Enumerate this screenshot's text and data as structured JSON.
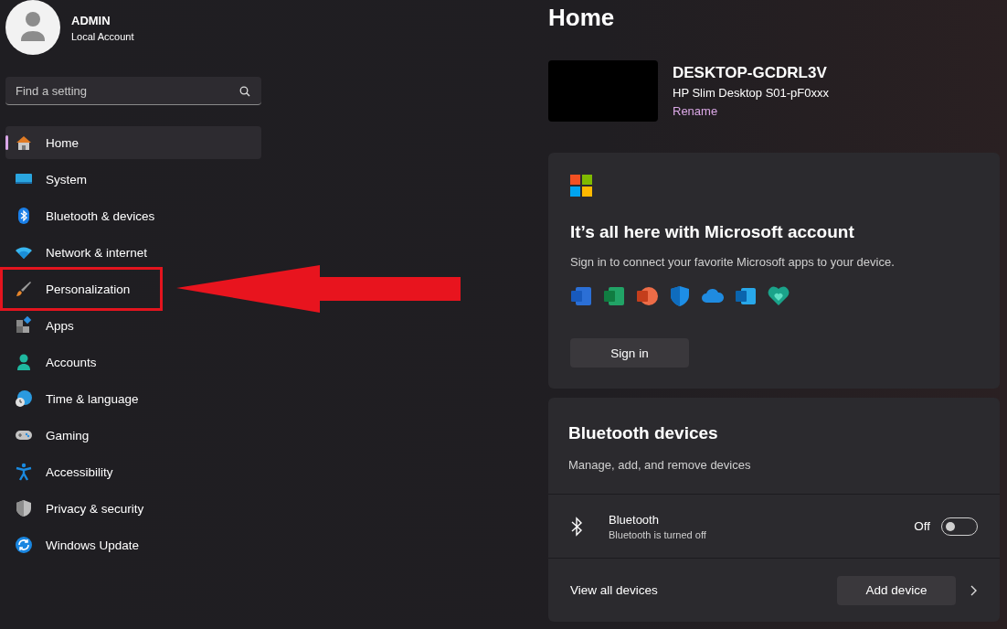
{
  "user": {
    "name": "ADMIN",
    "account_type": "Local Account"
  },
  "search": {
    "placeholder": "Find a setting"
  },
  "nav": [
    {
      "label": "Home",
      "selected": true,
      "highlighted": false
    },
    {
      "label": "System",
      "selected": false,
      "highlighted": false
    },
    {
      "label": "Bluetooth & devices",
      "selected": false,
      "highlighted": false
    },
    {
      "label": "Network & internet",
      "selected": false,
      "highlighted": false
    },
    {
      "label": "Personalization",
      "selected": false,
      "highlighted": true
    },
    {
      "label": "Apps",
      "selected": false,
      "highlighted": false
    },
    {
      "label": "Accounts",
      "selected": false,
      "highlighted": false
    },
    {
      "label": "Time & language",
      "selected": false,
      "highlighted": false
    },
    {
      "label": "Gaming",
      "selected": false,
      "highlighted": false
    },
    {
      "label": "Accessibility",
      "selected": false,
      "highlighted": false
    },
    {
      "label": "Privacy & security",
      "selected": false,
      "highlighted": false
    },
    {
      "label": "Windows Update",
      "selected": false,
      "highlighted": false
    }
  ],
  "page": {
    "title": "Home"
  },
  "device": {
    "name": "DESKTOP-GCDRL3V",
    "model": "HP Slim Desktop S01-pF0xxx",
    "rename_link": "Rename"
  },
  "account_card": {
    "title": "It’s all here with Microsoft account",
    "text": "Sign in to connect your favorite Microsoft apps to your device.",
    "button": "Sign in"
  },
  "bluetooth_card": {
    "title": "Bluetooth devices",
    "subtitle": "Manage, add, and remove devices",
    "setting": {
      "name": "Bluetooth",
      "status": "Bluetooth is turned off",
      "state_label": "Off",
      "on": false
    },
    "footer_link": "View all devices",
    "button": "Add device"
  }
}
